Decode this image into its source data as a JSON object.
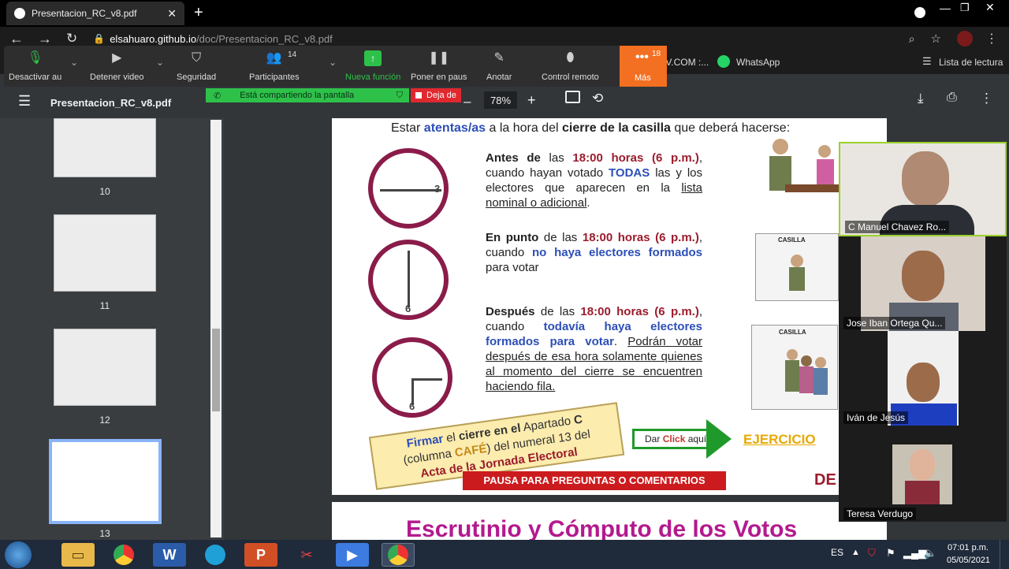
{
  "browser": {
    "tab_title": "Presentacion_RC_v8.pdf",
    "url_host": "elsahuaro.github.io",
    "url_path": "/doc/Presentacion_RC_v8.pdf"
  },
  "bookmarks": {
    "iv": "IV.COM :...",
    "whatsapp": "WhatsApp",
    "reading_list": "Lista de lectura"
  },
  "zoom": {
    "mute": "Desactivar au",
    "video": "Detener video",
    "security": "Seguridad",
    "participants": "Participantes",
    "participants_count": "14",
    "new_feature": "Nueva función",
    "pause": "Poner en paus",
    "annotate": "Anotar",
    "remote": "Control remoto",
    "more": "Más",
    "more_badge": "18",
    "sharing": "Está compartiendo la pantalla",
    "stop": "Deja de"
  },
  "pdf": {
    "title": "Presentacion_RC_v8.pdf",
    "zoom": "78%",
    "minus": "–",
    "plus": "+"
  },
  "thumbs": [
    "10",
    "11",
    "12",
    "13"
  ],
  "slide": {
    "header_pre": "Estar",
    "header_blue": "atentas/as",
    "header_mid": "a la hora del",
    "header_bold": "cierre de la casilla",
    "header_post": "que deberá hacerse:",
    "p1": {
      "a": "Antes de",
      "b": "las",
      "c": "18:00 horas (6 p.m.)",
      "d": ", cuando hayan votado",
      "e": "TODAS",
      "f": "las y los electores que aparecen en la",
      "g": "lista nominal o adicional",
      "h": "."
    },
    "p2": {
      "a": "En punto",
      "b": "de las",
      "c": "18:00 horas (6 p.m.)",
      "d": ", cuando",
      "e": "no haya electores formados",
      "f": "para votar"
    },
    "p3": {
      "a": "Después",
      "b": "de las",
      "c": "18:00 horas (6 p.m.)",
      "d": ", cuando",
      "e": "todavía haya electores formados para votar",
      "f": ".",
      "g": "Podrán votar después de esa hora solamente quienes al momento del cierre se encuentren haciendo fila."
    },
    "clock_labels": {
      "three": "3",
      "six_a": "6",
      "six_b": "6"
    },
    "casilla1": "CASILLA",
    "casilla2": "CASILLA",
    "note": {
      "a": "Firmar",
      "b": "el",
      "c": "cierre en el",
      "d": "Apartado",
      "e": "C",
      "f": "(columna",
      "g": "CAFÉ",
      "h": ") del numeral 13 del",
      "i": "Acta de la Jornada Electoral"
    },
    "click": {
      "a": "Dar",
      "b": "Click",
      "c": "aquí"
    },
    "ejercicio": "EJERCICIO",
    "pausa": "PAUSA PARA PREGUNTAS O COMENTARIOS",
    "logo": "DE",
    "next_title": "Escrutinio y Cómputo de los Votos"
  },
  "participants": [
    {
      "name": "C Manuel Chavez Ro..."
    },
    {
      "name": "Jose Iban Ortega Qu..."
    },
    {
      "name": "Iván de Jesús"
    },
    {
      "name": "Teresa Verdugo"
    }
  ],
  "taskbar": {
    "lang": "ES",
    "time": "07:01 p.m.",
    "date": "05/05/2021"
  }
}
